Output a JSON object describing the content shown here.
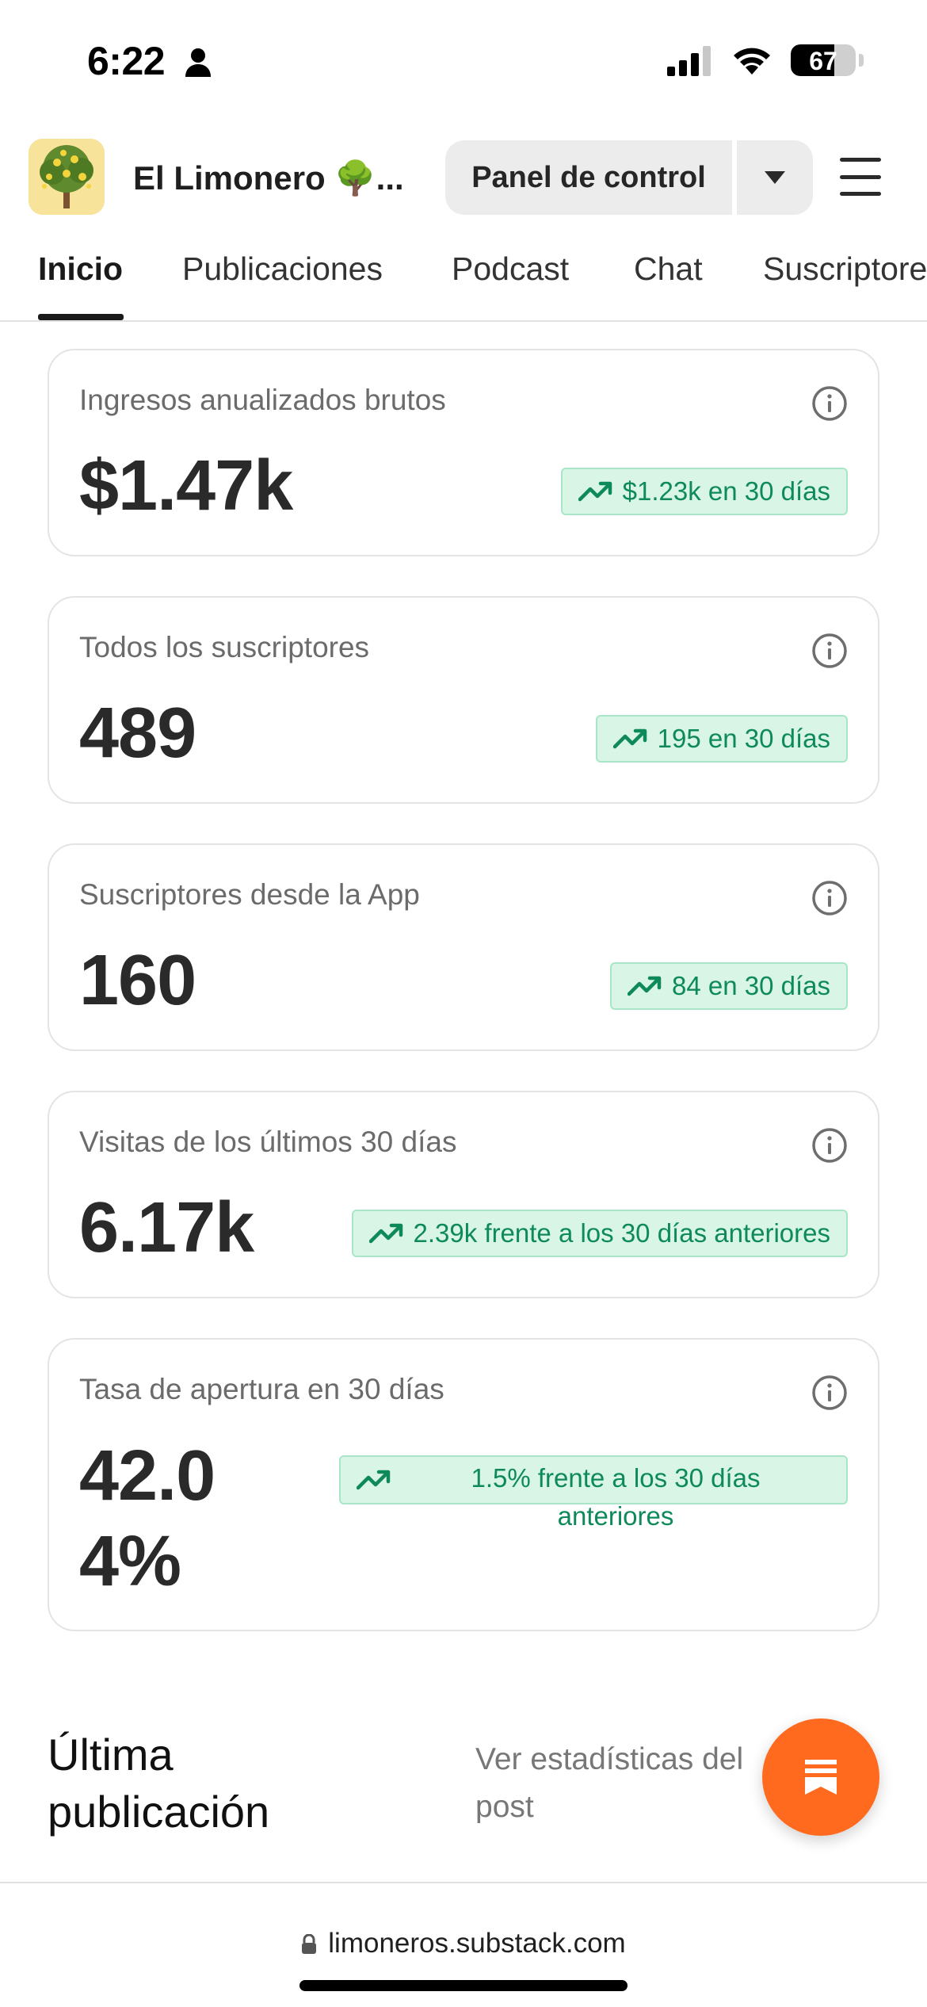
{
  "status_bar": {
    "time": "6:22",
    "battery": "67",
    "battery_level": 0.67
  },
  "header": {
    "publication_name": "El Limonero 🌳...",
    "panel_button_label": "Panel de control"
  },
  "tabs": [
    {
      "label": "Inicio",
      "active": true
    },
    {
      "label": "Publicaciones",
      "active": false
    },
    {
      "label": "Podcast",
      "active": false
    },
    {
      "label": "Chat",
      "active": false
    },
    {
      "label": "Suscriptores",
      "active": false
    }
  ],
  "stats": [
    {
      "label": "Ingresos anualizados brutos",
      "value": "$1.47k",
      "trend": "$1.23k en 30 días"
    },
    {
      "label": "Todos los suscriptores",
      "value": "489",
      "trend": "195 en 30 días"
    },
    {
      "label": "Suscriptores desde la App",
      "value": "160",
      "trend": "84 en 30 días"
    },
    {
      "label": "Visitas de los últimos 30 días",
      "value": "6.17k",
      "trend": "2.39k frente a los 30 días anteriores"
    },
    {
      "label": "Tasa de apertura en 30 días",
      "value_line1": "42.0",
      "value_line2": "4%",
      "trend_line1": "1.5% frente a los 30 días",
      "trend_line2": "anteriores"
    }
  ],
  "last_post": {
    "title_line1": "Última",
    "title_line2": "publicación",
    "link_line1": "Ver estadísticas del",
    "link_line2": "post"
  },
  "browser": {
    "url": "limoneros.substack.com"
  },
  "colors": {
    "trend_green": "#0e8a5a",
    "trend_bg": "#d8f5e6",
    "fab_orange": "#ff6a1f"
  }
}
